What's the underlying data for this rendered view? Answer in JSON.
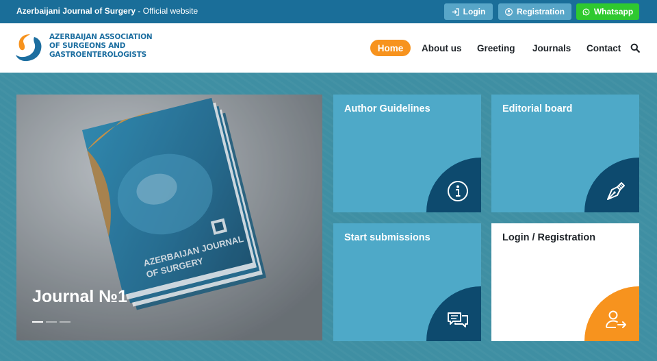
{
  "topbar": {
    "site_name": "Azerbaijani Journal of Surgery",
    "site_suffix": " - Official website",
    "login_label": "Login",
    "registration_label": "Registration",
    "whatsapp_label": "Whatsapp"
  },
  "header": {
    "logo_line1": "AZERBAIJAN ASSOCIATION",
    "logo_line2": "OF SURGEONS AND",
    "logo_line3": "GASTROENTEROLOGISTS",
    "nav": [
      {
        "label": "Home",
        "active": true
      },
      {
        "label": "About us"
      },
      {
        "label": "Greeting"
      },
      {
        "label": "Journals"
      },
      {
        "label": "Contact"
      }
    ],
    "search_icon": "search-icon"
  },
  "slider": {
    "title": "Journal №1",
    "book_title_line1": "AZERBAIJAN JOURNAL",
    "book_title_line2": "OF SURGERY",
    "slide_count": 3,
    "active_slide": 1
  },
  "tiles": [
    {
      "title": "Author Guidelines",
      "icon": "info-icon"
    },
    {
      "title": "Editorial board",
      "icon": "pen-nib-icon"
    },
    {
      "title": "Start submissions",
      "icon": "chat-icon"
    },
    {
      "title": "Login / Registration",
      "icon": "user-arrow-icon"
    }
  ],
  "colors": {
    "topbar": "#1a6e99",
    "accent_orange": "#f7931e",
    "tile_blue": "#4ea9c8",
    "tile_corner_dark": "#0d4a6e",
    "whatsapp_green": "#2fc92f",
    "background": "#3f8fa3"
  }
}
